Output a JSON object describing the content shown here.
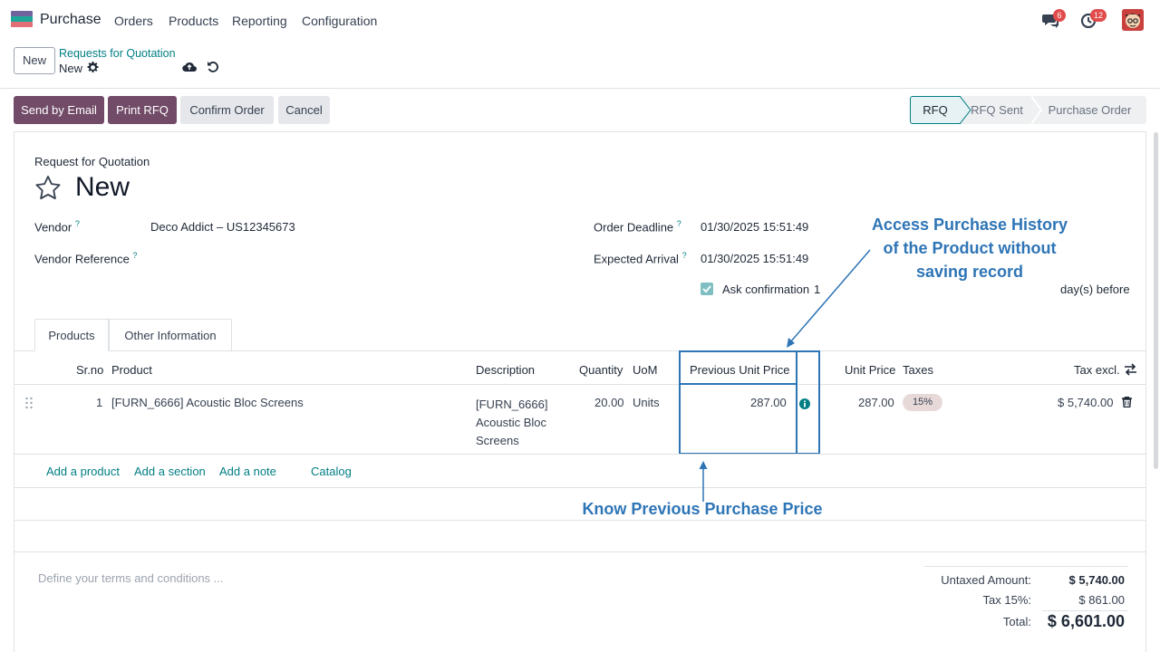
{
  "app": {
    "name": "Purchase"
  },
  "menu": [
    "Orders",
    "Products",
    "Reporting",
    "Configuration"
  ],
  "systray": {
    "messages_badge": "6",
    "activity_badge": "12"
  },
  "control_panel": {
    "new_button": "New",
    "breadcrumb_parent": "Requests for Quotation",
    "breadcrumb_current": "New"
  },
  "actions": {
    "send_email": "Send by Email",
    "print_rfq": "Print RFQ",
    "confirm_order": "Confirm Order",
    "cancel": "Cancel"
  },
  "statusbar": {
    "states": [
      "RFQ",
      "RFQ Sent",
      "Purchase Order"
    ],
    "active": "RFQ"
  },
  "form": {
    "doc_type": "Request for Quotation",
    "title": "New",
    "vendor_label": "Vendor",
    "vendor_value": "Deco Addict – US12345673",
    "vendor_ref_label": "Vendor Reference",
    "order_deadline_label": "Order Deadline",
    "order_deadline_value": "01/30/2025 15:51:49",
    "expected_arrival_label": "Expected Arrival",
    "expected_arrival_value": "01/30/2025 15:51:49",
    "ask_confirmation_label": "Ask confirmation",
    "ask_confirmation_days": "1",
    "days_before": "day(s) before"
  },
  "tabs": [
    "Products",
    "Other Information"
  ],
  "table": {
    "headers": {
      "srno": "Sr.no",
      "product": "Product",
      "description": "Description",
      "quantity": "Quantity",
      "uom": "UoM",
      "prev_price": "Previous Unit Price",
      "unit_price": "Unit Price",
      "taxes": "Taxes",
      "tax_excl": "Tax excl."
    },
    "rows": [
      {
        "srno": "1",
        "product": "[FURN_6666] Acoustic Bloc Screens",
        "description_lines": [
          "[FURN_6666]",
          "Acoustic Bloc",
          "Screens"
        ],
        "quantity": "20.00",
        "uom": "Units",
        "prev_price": "287.00",
        "unit_price": "287.00",
        "tax": "15%",
        "subtotal": "$ 5,740.00"
      }
    ],
    "add_links": [
      "Add a product",
      "Add a section",
      "Add a note",
      "Catalog"
    ]
  },
  "annotations": {
    "history_lines": [
      "Access Purchase History",
      "of the Product without",
      "saving record"
    ],
    "price_note": "Know Previous Purchase Price"
  },
  "footer": {
    "terms_placeholder": "Define your terms and conditions ...",
    "untaxed_label": "Untaxed Amount:",
    "untaxed_value": "$ 5,740.00",
    "tax_label": "Tax 15%:",
    "tax_value": "$ 861.00",
    "total_label": "Total:",
    "total_value": "$ 6,601.00"
  }
}
